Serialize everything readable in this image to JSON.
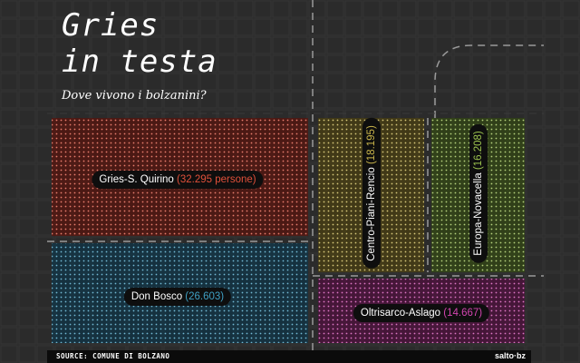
{
  "title_line1": "Gries",
  "title_line2": "in testa",
  "subtitle": "Dove vivono i bolzanini?",
  "source": "SOURCE: COMUNE DI BOLZANO",
  "logo": "salto·bz",
  "colors": {
    "background": "#2b2b2b",
    "gries": "#e0503a",
    "donbosco": "#3fa0c4",
    "centro": "#c8b44a",
    "europa": "#9bc24e",
    "oltrisarco": "#d245b0"
  },
  "chart_data": {
    "type": "treemap",
    "unit": "persone",
    "districts": [
      {
        "id": "gries",
        "label": "Gries-S. Quirino",
        "value_text": "32.295",
        "value": 32295,
        "unit_text": "persone",
        "color": "#e0503a",
        "orientation": "horizontal"
      },
      {
        "id": "donbosco",
        "label": "Don Bosco",
        "value_text": "26.603",
        "value": 26603,
        "color": "#3fa0c4",
        "orientation": "horizontal"
      },
      {
        "id": "centro",
        "label": "Centro-Piani-Rencio",
        "value_text": "18.195",
        "value": 18195,
        "color": "#c8b44a",
        "orientation": "vertical"
      },
      {
        "id": "europa",
        "label": "Europa-Novacella",
        "value_text": "16.208",
        "value": 16208,
        "color": "#9bc24e",
        "orientation": "vertical"
      },
      {
        "id": "oltrisarco",
        "label": "Oltrisarco-Aslago",
        "value_text": "14.667",
        "value": 14667,
        "color": "#d245b0",
        "orientation": "horizontal"
      }
    ]
  }
}
